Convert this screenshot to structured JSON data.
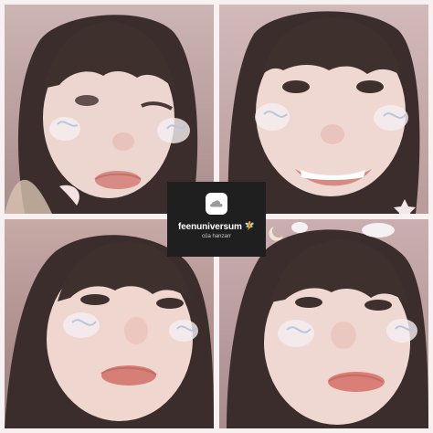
{
  "overlay": {
    "title": "feenuniversum",
    "title_emoji": "🧚",
    "subtitle": "của hanzarr",
    "icon": "cloud-icon"
  },
  "photos": [
    {
      "name": "top-left",
      "icon": "portrait"
    },
    {
      "name": "top-right",
      "icon": "portrait"
    },
    {
      "name": "bottom-left",
      "icon": "portrait"
    },
    {
      "name": "bottom-right",
      "icon": "portrait"
    }
  ],
  "colors": {
    "background": "#f7f1f2",
    "badge": "#1f1f1f",
    "skin": "#efd8d2",
    "hair": "#3a2d2b",
    "lips": "#d97f77"
  }
}
